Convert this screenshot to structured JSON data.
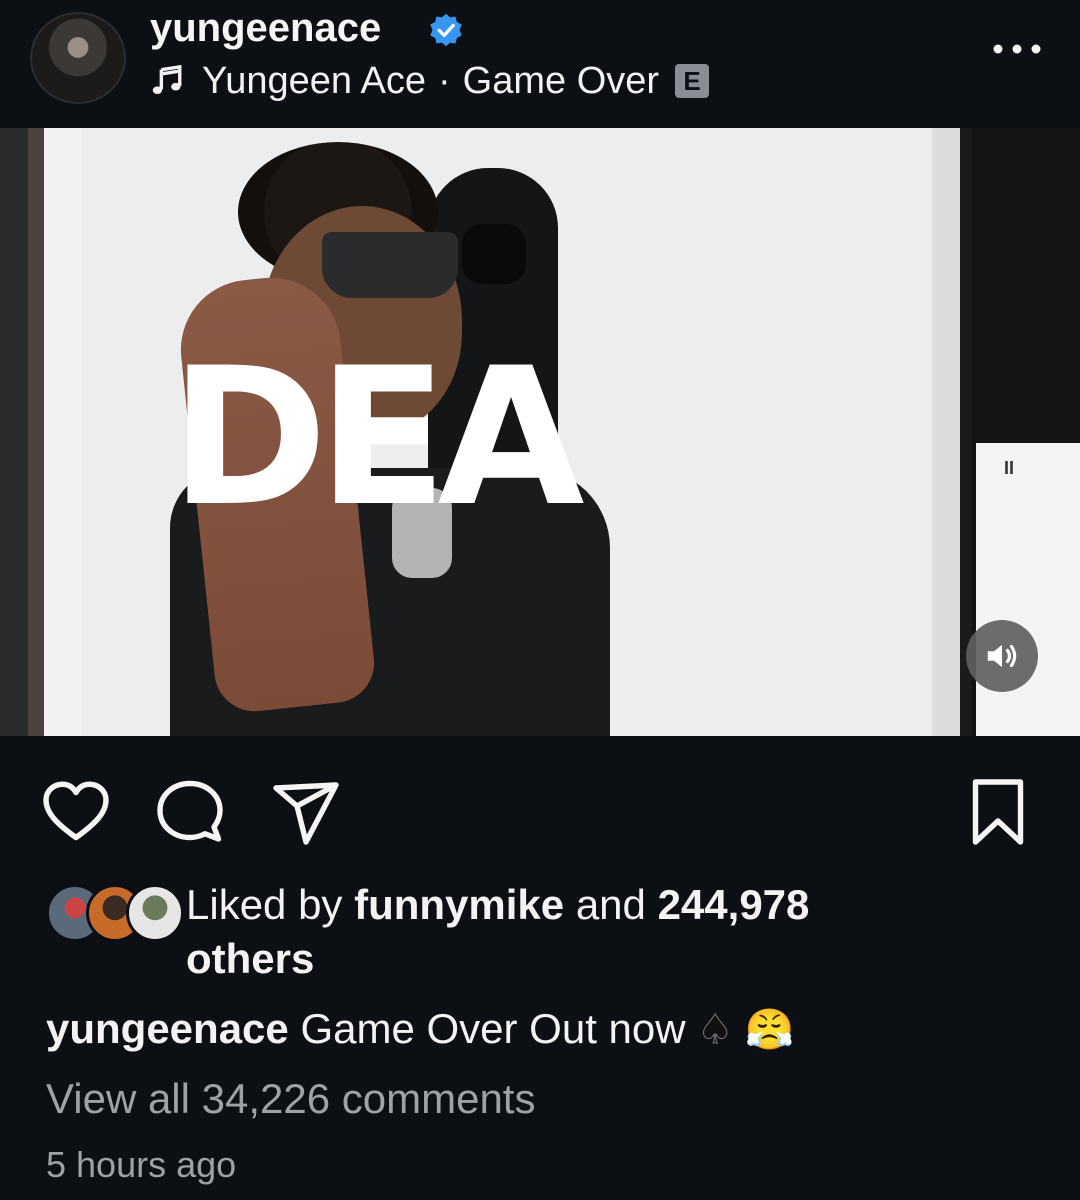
{
  "post_header": {
    "username": "yungeenace",
    "verified": true,
    "audio_artist": "Yungeen Ace",
    "audio_separator": "·",
    "audio_title": "Game Over",
    "explicit_badge": "E"
  },
  "media": {
    "overlay_text": "DEA",
    "audio_control": "speaker-icon"
  },
  "actions": {
    "like": "heart-icon",
    "comment": "comment-icon",
    "share": "paper-plane-icon",
    "save": "bookmark-icon"
  },
  "likes": {
    "prefix": "Liked by ",
    "user": "funnymike",
    "middle": " and ",
    "count": "244,978",
    "suffix": "others"
  },
  "caption": {
    "username": "yungeenace",
    "text": "Game Over Out now",
    "emojis": [
      "♠",
      "😤"
    ]
  },
  "comments": {
    "view_all": "View all 34,226 comments"
  },
  "timestamp": "5 hours ago",
  "colors": {
    "background": "#0c0f14",
    "verified_blue": "#3797f0",
    "muted_text": "#9ea1a6"
  }
}
